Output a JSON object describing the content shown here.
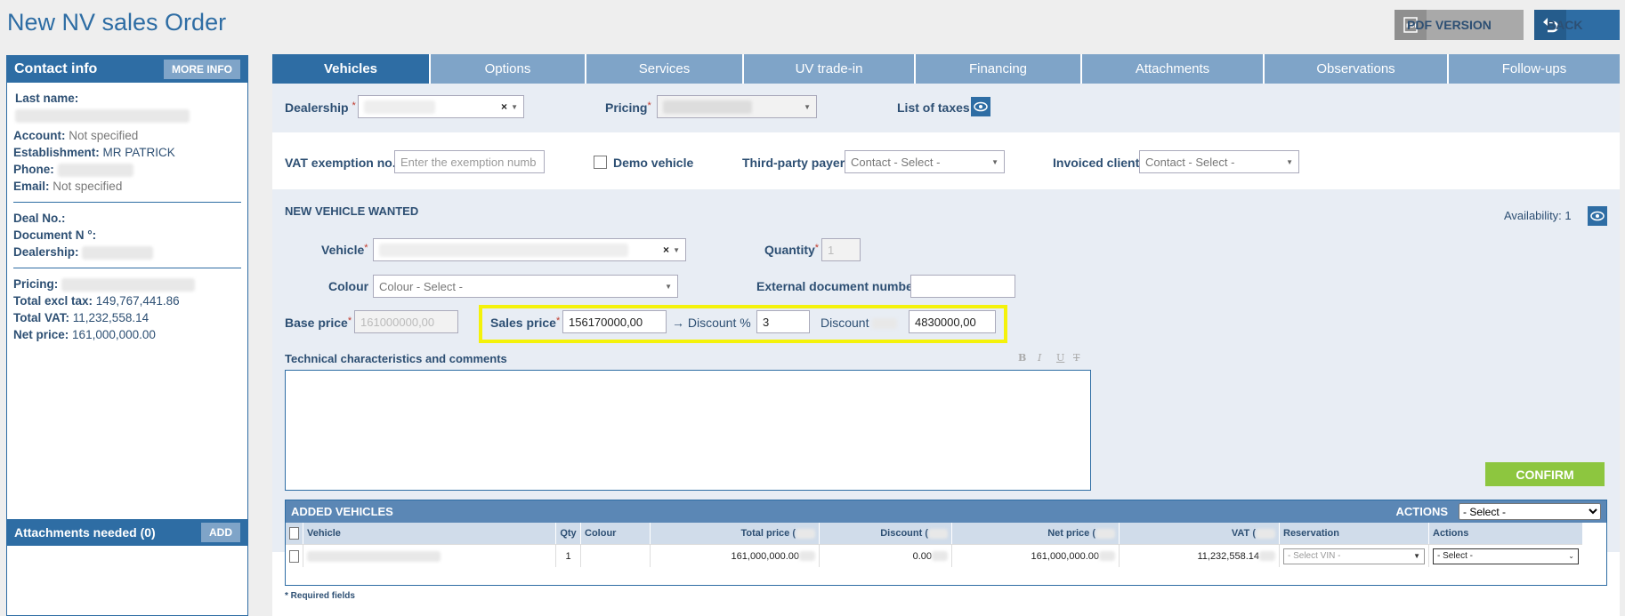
{
  "page": {
    "title": "New NV sales Order"
  },
  "toolbar": {
    "pdf_label": "PDF VERSION",
    "back_label": "BACK",
    "pdf_icon": "pdf-icon",
    "back_icon": "undo-icon"
  },
  "contact": {
    "title": "Contact info",
    "more_info": "MORE INFO",
    "last_name_label": "Last name:",
    "account_label": "Account:",
    "account_value": "Not specified",
    "establishment_label": "Establishment:",
    "establishment_value": "MR PATRICK",
    "phone_label": "Phone:",
    "email_label": "Email:",
    "email_value": "Not specified",
    "deal_label": "Deal No.:",
    "document_label": "Document N °:",
    "dealership_label": "Dealership:",
    "pricing_label": "Pricing:",
    "total_excl_label": "Total excl tax:",
    "total_excl_value": "149,767,441.86",
    "total_vat_label": "Total VAT:",
    "total_vat_value": "11,232,558.14",
    "net_price_label": "Net price:",
    "net_price_value": "161,000,000.00"
  },
  "attachments": {
    "title": "Attachments needed (0)",
    "add": "ADD"
  },
  "tabs": [
    {
      "label": "Vehicles",
      "active": true
    },
    {
      "label": "Options"
    },
    {
      "label": "Services"
    },
    {
      "label": "UV trade-in"
    },
    {
      "label": "Financing"
    },
    {
      "label": "Attachments"
    },
    {
      "label": "Observations"
    },
    {
      "label": "Follow-ups"
    }
  ],
  "form": {
    "dealership_label": "Dealership",
    "pricing_label": "Pricing",
    "list_of_taxes_label": "List of taxes",
    "vat_label": "VAT exemption no.",
    "vat_placeholder": "Enter the exemption numb",
    "demo_label": "Demo vehicle",
    "third_party_label": "Third-party payer",
    "third_party_value": "Contact - Select -",
    "invoiced_label": "Invoiced client",
    "invoiced_value": "Contact - Select -",
    "section_title": "NEW VEHICLE WANTED",
    "availability": "Availability: 1",
    "vehicle_label": "Vehicle",
    "quantity_label": "Quantity",
    "quantity_value": "1",
    "colour_label": "Colour",
    "colour_value": "Colour - Select -",
    "external_doc_label": "External document number",
    "base_price_label": "Base price",
    "base_price_value": "161000000,00",
    "sales_price_label": "Sales price",
    "sales_price_value": "156170000,00",
    "discount_pct_label": "→ Discount %",
    "discount_pct_value": "3",
    "discount_label": "Discount",
    "discount_value": "4830000,00",
    "tech_label": "Technical characteristics and comments",
    "fmt_bold": "B",
    "fmt_italic": "I",
    "fmt_underline": "U",
    "fmt_clear": "T",
    "confirm": "CONFIRM"
  },
  "added": {
    "title": "ADDED VEHICLES",
    "actions_label": "ACTIONS",
    "actions_select": "- Select -",
    "headers": [
      "Vehicle",
      "Qty",
      "Colour",
      "Total price (",
      "Discount (",
      "Net price (",
      "VAT (",
      "Reservation",
      "Actions"
    ],
    "row": {
      "qty": "1",
      "total_price": "161,000,000.00",
      "discount": "0.00",
      "net_price": "161,000,000.00",
      "vat": "11,232,558.14",
      "reservation": "- Select VIN -",
      "actions": "- Select -"
    }
  },
  "footer": {
    "required": "* Required fields"
  }
}
